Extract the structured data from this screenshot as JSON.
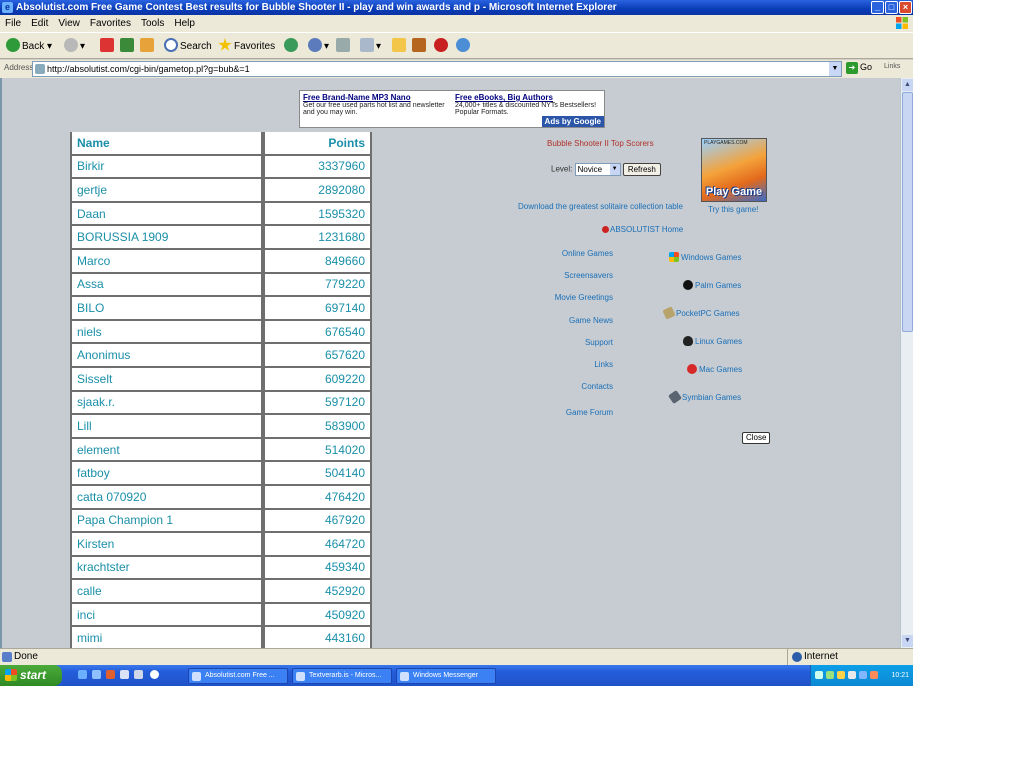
{
  "window": {
    "title": "Absolutist.com Free Game Contest Best results for Bubble Shooter II - play and win awards and p - Microsoft Internet Explorer",
    "minimize_glyph": "_",
    "maximize_glyph": "□",
    "close_glyph": "×"
  },
  "menu": [
    "File",
    "Edit",
    "View",
    "Favorites",
    "Tools",
    "Help"
  ],
  "toolbar": {
    "back": "Back",
    "search": "Search",
    "favorites": "Favorites"
  },
  "address": {
    "label": "Address",
    "url": "http://absolutist.com/cgi-bin/gametop.pl?g=bub&=1",
    "go": "Go",
    "links": "Links"
  },
  "ads": [
    {
      "title": "Free Brand-Name MP3 Nano",
      "text": "Get our free used parts hot list and newsletter and you may win."
    },
    {
      "title": "Free eBooks, Big Authors",
      "text": "24,000+ titles & discounted NYTs Bestsellers! Popular Formats."
    }
  ],
  "ads_by": "Ads by Google",
  "scores": {
    "header": {
      "name": "Name",
      "points": "Points"
    },
    "rows": [
      {
        "name": "Birkir",
        "points": "3337960"
      },
      {
        "name": "gertje",
        "points": "2892080"
      },
      {
        "name": "Daan",
        "points": "1595320"
      },
      {
        "name": "BORUSSIA 1909",
        "points": "1231680"
      },
      {
        "name": "Marco",
        "points": "849660"
      },
      {
        "name": "Assa",
        "points": "779220"
      },
      {
        "name": "BILO",
        "points": "697140"
      },
      {
        "name": "niels",
        "points": "676540"
      },
      {
        "name": "Anonimus",
        "points": "657620"
      },
      {
        "name": "Sisselt",
        "points": "609220"
      },
      {
        "name": "sjaak.r.",
        "points": "597120"
      },
      {
        "name": "Lill",
        "points": "583900"
      },
      {
        "name": "element",
        "points": "514020"
      },
      {
        "name": "fatboy",
        "points": "504140"
      },
      {
        "name": "catta 070920",
        "points": "476420"
      },
      {
        "name": "Papa Champion 1",
        "points": "467920"
      },
      {
        "name": "Kirsten",
        "points": "464720"
      },
      {
        "name": "krachtster",
        "points": "459340"
      },
      {
        "name": "calle",
        "points": "452920"
      },
      {
        "name": "inci",
        "points": "450920"
      },
      {
        "name": "mimi",
        "points": "443160"
      }
    ]
  },
  "panel": {
    "title": "Bubble Shooter II Top Scorers",
    "level_label": "Level:",
    "level_value": "Novice",
    "refresh": "Refresh",
    "thumb_caption": "PLAYGAMES.COM",
    "play_game": "Play Game",
    "try_game": "Try this game!",
    "download": "Download the greatest solitaire collection table",
    "home": "ABSOLUTIST Home",
    "close": "Close"
  },
  "left_links": [
    "Online Games",
    "Screensavers",
    "Movie Greetings",
    "Game News",
    "Support",
    "Links",
    "Contacts",
    "Game Forum"
  ],
  "right_links": [
    "Windows Games",
    "Palm Games",
    "PocketPC Games",
    "Linux Games",
    "Mac Games",
    "Symbian Games"
  ],
  "status": {
    "text": "Done",
    "zone": "Internet"
  },
  "taskbar": {
    "start": "start",
    "tasks": [
      "Absolutist.com Free ...",
      "Textverarb.is - Micros...",
      "Windows Messenger"
    ],
    "clock": "10:21"
  }
}
